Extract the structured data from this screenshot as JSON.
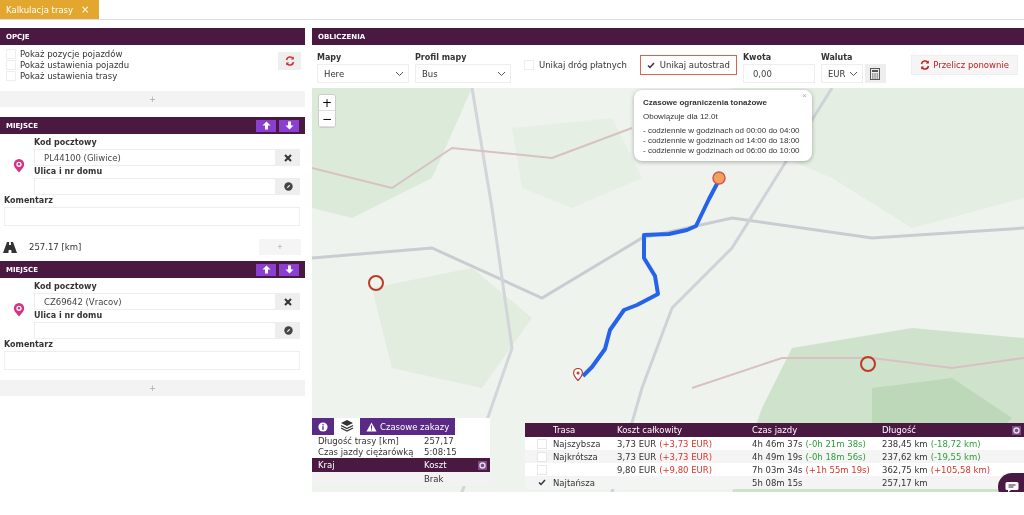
{
  "tab": {
    "label": "Kalkulacja trasy",
    "close": "×",
    "selected": true
  },
  "options": {
    "title": "OPCJE",
    "checkboxes": [
      {
        "label": "Pokaż pozycje pojazdów",
        "checked": false
      },
      {
        "label": "Pokaż ustawienia pojazdu",
        "checked": false
      },
      {
        "label": "Pokaż ustawienia trasy",
        "checked": false
      }
    ],
    "add": "+"
  },
  "places": [
    {
      "title": "MIEJSCE",
      "postal_label": "Kod pocztowy",
      "postal_value": "PL44100 (Gliwice)",
      "street_label": "Ulica i nr domu",
      "comment_label": "Komentarz"
    },
    {
      "title": "MIEJSCE",
      "postal_label": "Kod pocztowy",
      "postal_value": "CZ69642 (Vracov)",
      "street_label": "Ulica i nr domu",
      "comment_label": "Komentarz"
    }
  ],
  "distance": {
    "text": "257.17 [km]",
    "add": "+"
  },
  "bottom_add": "+",
  "calc": {
    "title": "OBLICZENIA",
    "maps": {
      "label": "Mapy",
      "value": "Here"
    },
    "profile": {
      "label": "Profil mapy",
      "value": "Bus"
    },
    "avoid": [
      {
        "label": "Unikaj dróg płatnych",
        "checked": false
      },
      {
        "label": "Unikaj autostrad",
        "checked": true
      }
    ],
    "amount": {
      "label": "Kwota",
      "value": "0,00"
    },
    "currency": {
      "label": "Waluta",
      "value": "EUR"
    },
    "recalc": "Przelicz ponownie"
  },
  "map": {
    "kind": "picture",
    "zoom_in": "+",
    "zoom_out": "−",
    "popup": {
      "title": "Czasowe ograniczenia tonażowe",
      "close": "×",
      "lines": [
        "Obowiązuje dla 12.0t"
      ],
      "schedule": [
        "- codziennie w godzinach od 00:00 do 04:00",
        "- codziennie w godzinach od 14:00 do 18:00",
        "- codziennie w godzinach od 06:00 do 10:00"
      ]
    }
  },
  "summary": {
    "bans_button": "Czasowe zakazy",
    "stats": [
      {
        "label": "Długość trasy [km]",
        "value": "257,17"
      },
      {
        "label": "Czas jazdy ciężarówką",
        "value": "5:08:15"
      }
    ],
    "columns": [
      "Kraj",
      "Koszt"
    ],
    "rows": [
      [
        "",
        "Brak"
      ]
    ]
  },
  "routes": {
    "columns": [
      "Trasa",
      "Koszt całkowity",
      "Czas jazdy",
      "Długość"
    ],
    "rows": [
      {
        "checked": false,
        "name": "Najszybsza",
        "cost": "3,73 EUR",
        "cost_delta": {
          "text": "(+3,73 EUR)",
          "worse": true
        },
        "time": "4h 46m 37s",
        "time_delta": {
          "text": "(-0h 21m 38s)",
          "worse": false
        },
        "length": "238,45 km",
        "length_delta": {
          "text": "(-18,72 km)",
          "worse": false
        }
      },
      {
        "checked": false,
        "name": "Najkrótsza",
        "cost": "3,73 EUR",
        "cost_delta": {
          "text": "(+3,73 EUR)",
          "worse": true
        },
        "time": "4h 49m 19s",
        "time_delta": {
          "text": "(-0h 18m 56s)",
          "worse": false
        },
        "length": "237,62 km",
        "length_delta": {
          "text": "(-19,55 km)",
          "worse": false
        }
      },
      {
        "checked": false,
        "cost": "9,80 EUR",
        "cost_delta": {
          "text": "(+9,80 EUR)",
          "worse": true
        },
        "time": "7h 03m 34s",
        "time_delta": {
          "text": "(+1h 55m 19s)",
          "worse": true
        },
        "length": "362,75 km",
        "length_delta": {
          "text": "(+105,58 km)",
          "worse": true
        }
      },
      {
        "checked": true,
        "name": "Najtańsza",
        "time": "5h 08m 15s",
        "length": "257,17 km"
      }
    ]
  }
}
